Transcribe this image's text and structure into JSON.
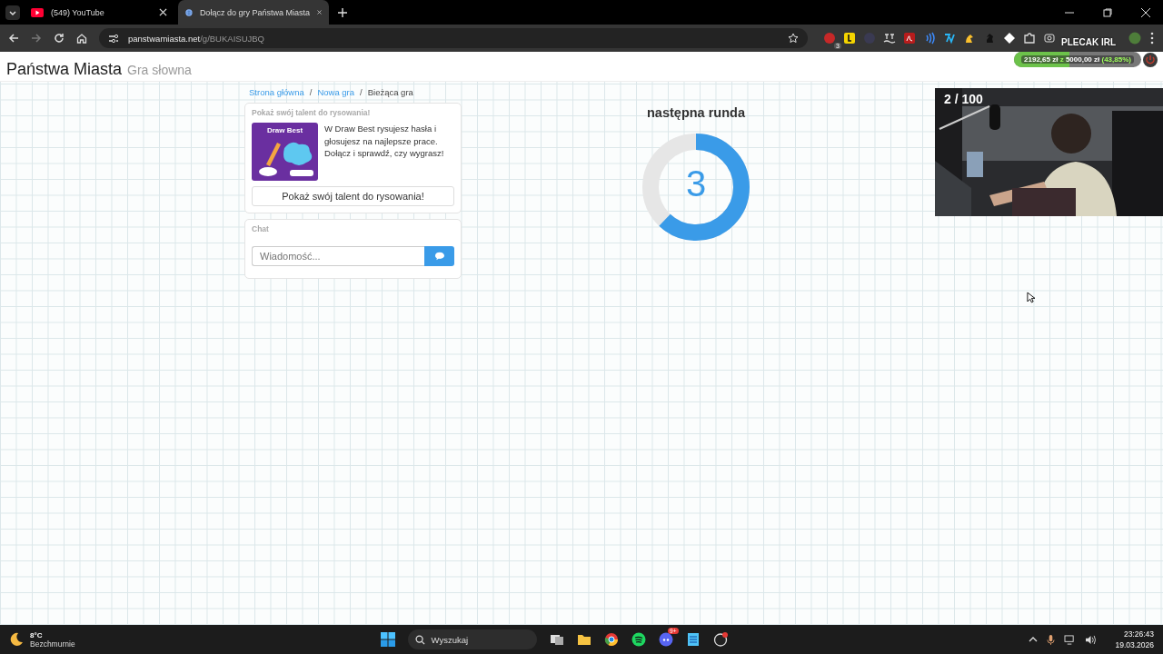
{
  "browser": {
    "tabs": [
      {
        "title": "(549) YouTube",
        "selected": false,
        "kind": "video"
      },
      {
        "title": "Dołącz do gry Państwa Miasta",
        "selected": true,
        "kind": "globe"
      }
    ],
    "url": {
      "host": "panstwamiasta.net",
      "path": "/g/BUKAISUJBQ"
    },
    "extension_badge": "3"
  },
  "header": {
    "title": "Państwa Miasta",
    "subtitle": "Gra słowna"
  },
  "breadcrumb": [
    {
      "label": "Strona główna",
      "link": true
    },
    {
      "separator": "/",
      "label": "Nowa gra",
      "link": true
    },
    {
      "separator": "/",
      "label": "Bieżąca gra",
      "link": false
    }
  ],
  "promo": {
    "heading": "Pokaż swój talent do rysowania!",
    "banner_title": "Draw Best",
    "text": "W Draw Best rysujesz hasła i głosujesz na najlepsze prace. Dołącz i sprawdź, czy wygrasz!",
    "button": "Pokaż swój talent do rysowania!"
  },
  "chat": {
    "heading": "Chat",
    "placeholder": "Wiadomość..."
  },
  "countdown": {
    "title": "następna runda",
    "number": "3",
    "level": 0.62
  },
  "webcam": {
    "kind": "picture",
    "counter": "2 / 100"
  },
  "overlay": {
    "title": "PLECAK IRL",
    "amount": "2192,65 zł",
    "separator": "z",
    "goal": "5000,00 zł",
    "percent": "(43,85%)",
    "level": 0.4385
  },
  "taskbar": {
    "temperature": "8°C",
    "condition": "Bezchmurnie",
    "search_placeholder": "Wyszukaj",
    "discord_badge": "9+",
    "time": "23:26:43",
    "date": "19.03.2026"
  }
}
